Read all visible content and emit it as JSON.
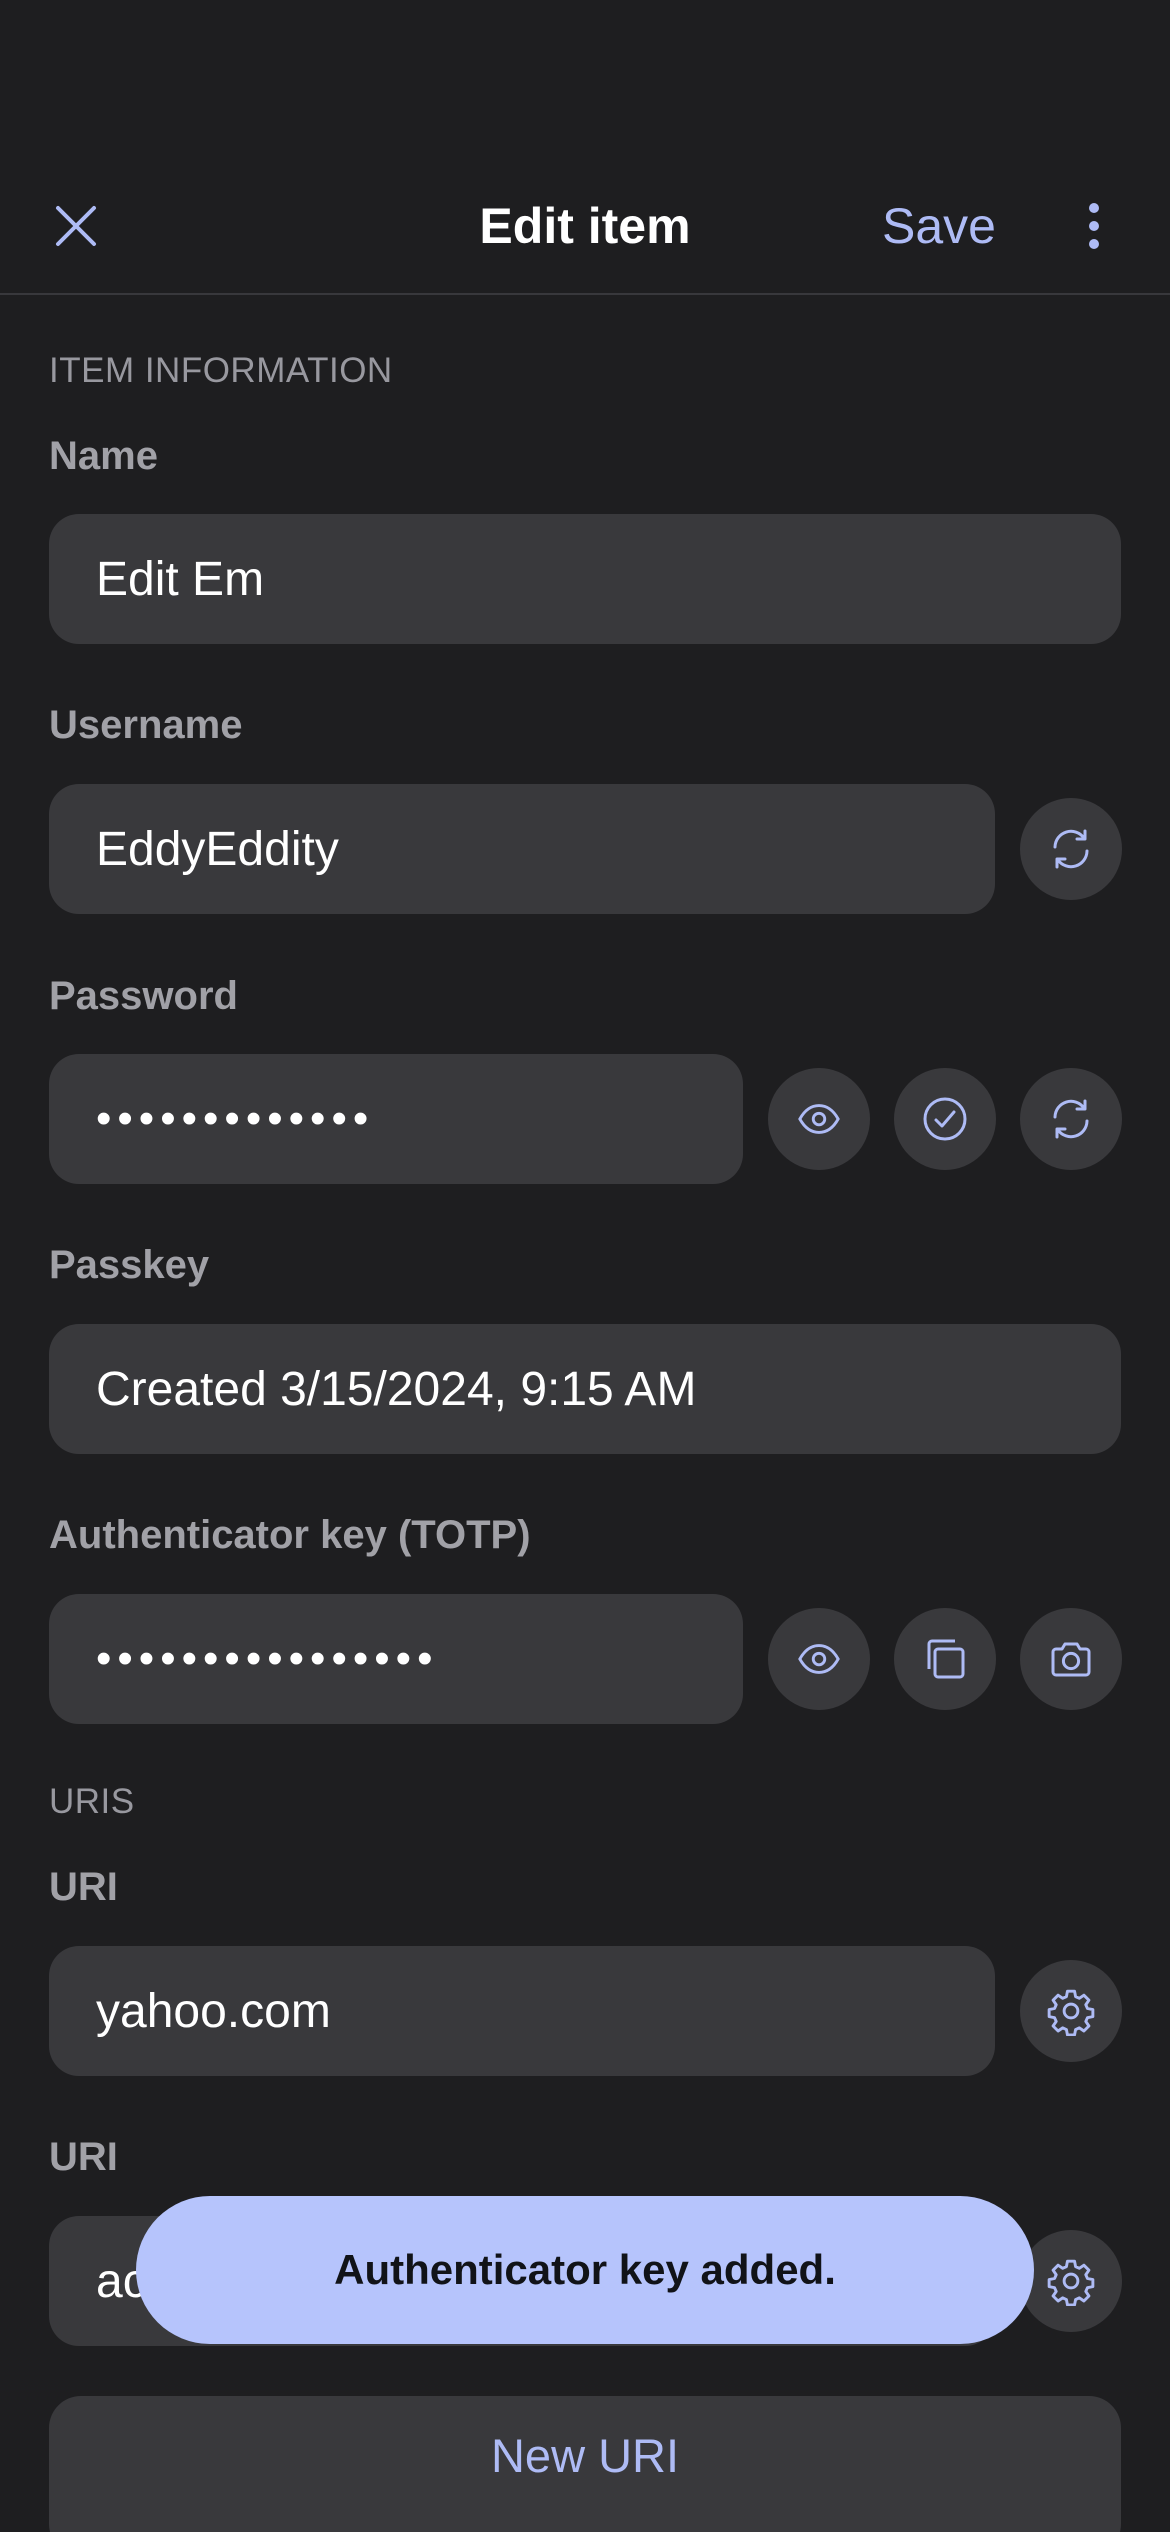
{
  "header": {
    "title": "Edit item",
    "save_label": "Save",
    "close_icon": "close-icon",
    "more_icon": "more-vertical-icon"
  },
  "sections": {
    "item_information": "ITEM INFORMATION",
    "uris": "URIS"
  },
  "fields": {
    "name": {
      "label": "Name",
      "value": "Edit Em"
    },
    "username": {
      "label": "Username",
      "value": "EddyEddity"
    },
    "password": {
      "label": "Password",
      "value": "•••••••••••••"
    },
    "passkey": {
      "label": "Passkey",
      "value": "Created 3/15/2024, 9:15 AM"
    },
    "totp": {
      "label": "Authenticator key (TOTP)",
      "value": "••••••••••••••••"
    }
  },
  "uris": [
    {
      "label": "URI",
      "value": "yahoo.com"
    },
    {
      "label": "URI",
      "value": "ac"
    }
  ],
  "new_uri_label": "New URI",
  "toast": {
    "message": "Authenticator key added."
  },
  "colors": {
    "background": "#1e1e20",
    "field": "#39393c",
    "accent": "#aebbf5",
    "toast": "#b6c4fc"
  }
}
